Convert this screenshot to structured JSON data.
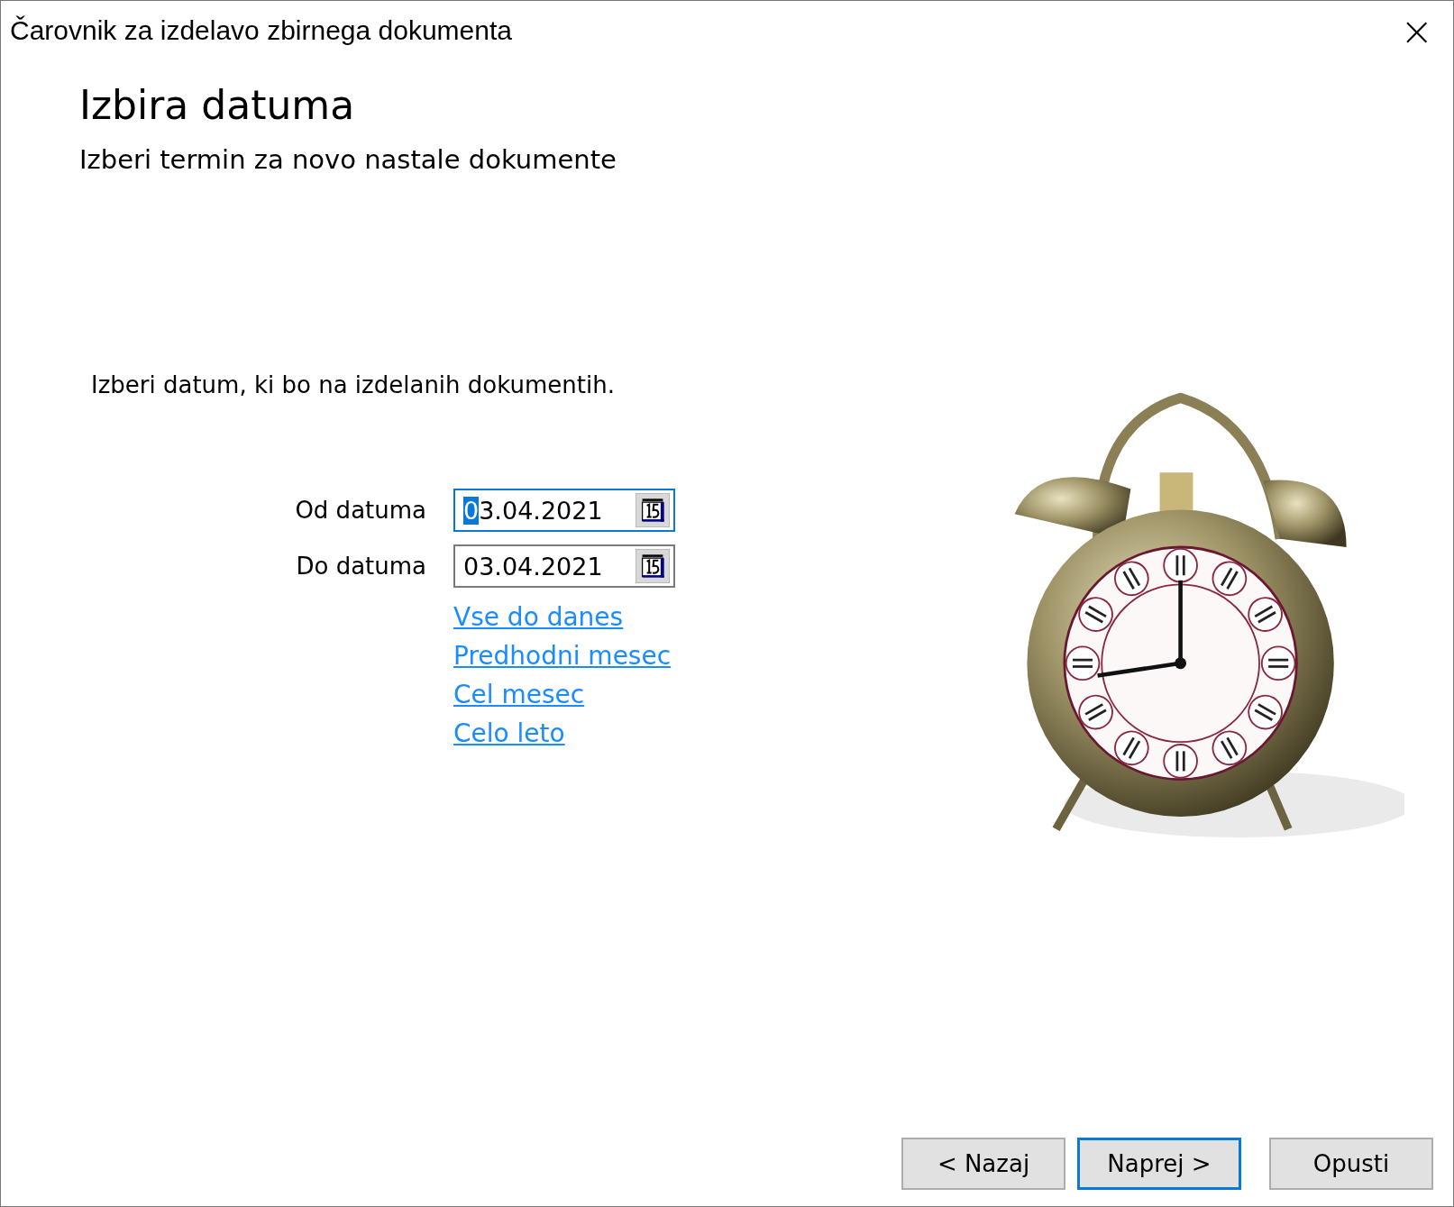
{
  "window": {
    "title": "Čarovnik za izdelavo zbirnega dokumenta",
    "close": "×"
  },
  "header": {
    "title": "Izbira datuma",
    "subtitle": "Izberi termin za novo nastale dokumente"
  },
  "instruction": "Izberi datum, ki bo na izdelanih dokumentih.",
  "date_fields": [
    {
      "label": "Od datuma",
      "value": "03.04.2021",
      "focused": true
    },
    {
      "label": "Do datuma",
      "value": "03.04.2021",
      "focused": false
    }
  ],
  "links": [
    "Vse do danes",
    "Predhodni mesec",
    "Cel mesec",
    "Celo leto"
  ],
  "buttons": [
    {
      "label": "< Nazaj",
      "focused": false
    },
    {
      "label": "Naprej >",
      "focused": true
    },
    {
      "label": "Opusti",
      "focused": false
    }
  ]
}
